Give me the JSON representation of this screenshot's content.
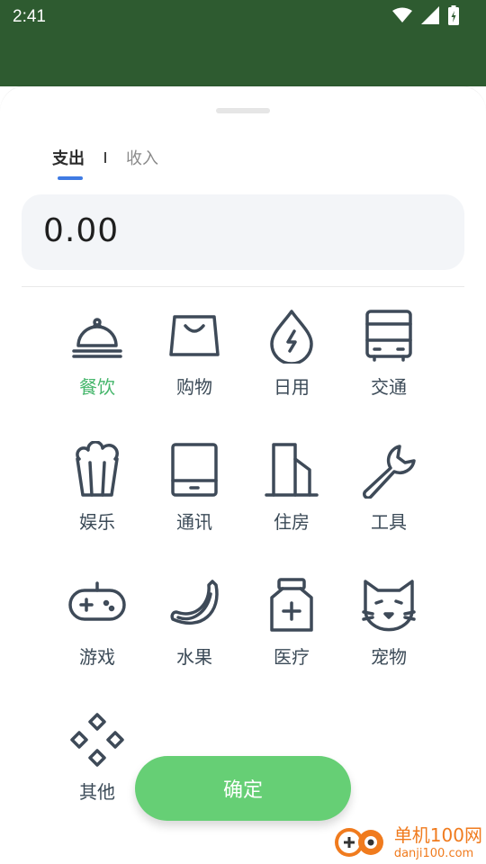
{
  "status": {
    "time": "2:41"
  },
  "tabs": [
    {
      "label": "支出",
      "active": true
    },
    {
      "label": "收入",
      "active": false
    }
  ],
  "amount": "0.00",
  "categories": [
    {
      "label": "餐饮",
      "icon": "cloche-icon",
      "selected": true
    },
    {
      "label": "购物",
      "icon": "shopping-bag-icon",
      "selected": false
    },
    {
      "label": "日用",
      "icon": "drop-lightning-icon",
      "selected": false
    },
    {
      "label": "交通",
      "icon": "bus-icon",
      "selected": false
    },
    {
      "label": "娱乐",
      "icon": "popcorn-icon",
      "selected": false
    },
    {
      "label": "通讯",
      "icon": "phone-device-icon",
      "selected": false
    },
    {
      "label": "住房",
      "icon": "building-icon",
      "selected": false
    },
    {
      "label": "工具",
      "icon": "wrench-icon",
      "selected": false
    },
    {
      "label": "游戏",
      "icon": "gamepad-icon",
      "selected": false
    },
    {
      "label": "水果",
      "icon": "banana-icon",
      "selected": false
    },
    {
      "label": "医疗",
      "icon": "medicine-bottle-icon",
      "selected": false
    },
    {
      "label": "宠物",
      "icon": "cat-icon",
      "selected": false
    },
    {
      "label": "其他",
      "icon": "diamonds-icon",
      "selected": false
    }
  ],
  "confirm_label": "确定",
  "watermark": {
    "line1": "单机100网",
    "line2": "danji100.com"
  },
  "colors": {
    "header_green": "#2e5b30",
    "accent_green": "#45b66b",
    "button_green": "#66cf75",
    "tab_indicator": "#3f7be3",
    "icon_stroke": "#3e4a58"
  }
}
